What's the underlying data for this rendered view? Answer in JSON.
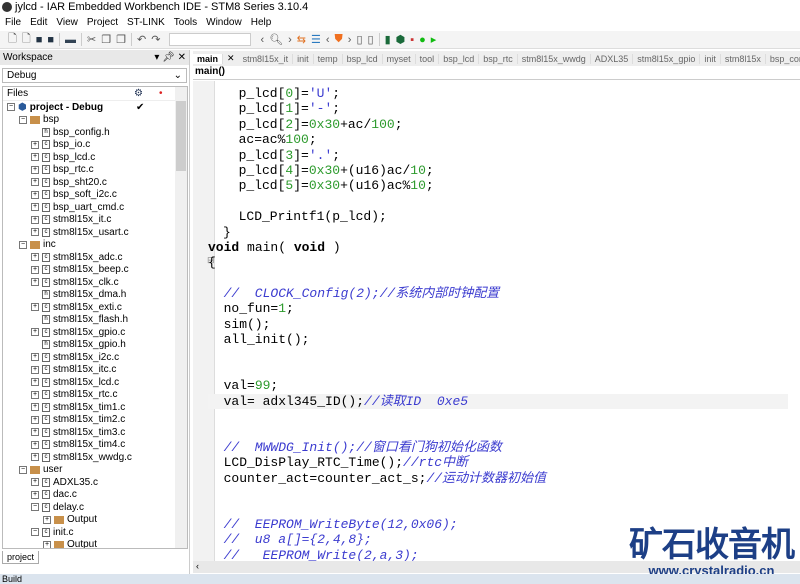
{
  "window": {
    "title": "jylcd - IAR Embedded Workbench IDE - STM8 Series 3.10.4"
  },
  "menu": [
    "File",
    "Edit",
    "View",
    "Project",
    "ST-LINK",
    "Tools",
    "Window",
    "Help"
  ],
  "toolbar": {
    "icons": [
      "new-file",
      "open",
      "save",
      "save-all",
      "print",
      "cut",
      "copy",
      "paste",
      "undo",
      "redo",
      "find-combo",
      "back",
      "find",
      "forward",
      "toggle-bookmark",
      "goto",
      "prev",
      "breakpoint",
      "next",
      "prev-bookmark",
      "next-bookmark",
      "compile",
      "make",
      "debug",
      "download-debug",
      "debug-no-download"
    ]
  },
  "workspace": {
    "title": "Workspace",
    "config": "Debug",
    "files_header": "Files",
    "tab": "project",
    "tree": [
      {
        "label": "project - Debug",
        "level": 0,
        "type": "project",
        "check": "✔"
      },
      {
        "label": "bsp",
        "level": 1,
        "type": "folder"
      },
      {
        "label": "bsp_config.h",
        "level": 2,
        "type": "h"
      },
      {
        "label": "bsp_io.c",
        "level": 2,
        "type": "c"
      },
      {
        "label": "bsp_lcd.c",
        "level": 2,
        "type": "c"
      },
      {
        "label": "bsp_rtc.c",
        "level": 2,
        "type": "c"
      },
      {
        "label": "bsp_sht20.c",
        "level": 2,
        "type": "c"
      },
      {
        "label": "bsp_soft_i2c.c",
        "level": 2,
        "type": "c"
      },
      {
        "label": "bsp_uart_cmd.c",
        "level": 2,
        "type": "c"
      },
      {
        "label": "stm8l15x_it.c",
        "level": 2,
        "type": "c"
      },
      {
        "label": "stm8l15x_usart.c",
        "level": 2,
        "type": "c"
      },
      {
        "label": "inc",
        "level": 1,
        "type": "folder"
      },
      {
        "label": "stm8l15x_adc.c",
        "level": 2,
        "type": "c"
      },
      {
        "label": "stm8l15x_beep.c",
        "level": 2,
        "type": "c"
      },
      {
        "label": "stm8l15x_clk.c",
        "level": 2,
        "type": "c"
      },
      {
        "label": "stm8l15x_dma.h",
        "level": 2,
        "type": "h"
      },
      {
        "label": "stm8l15x_exti.c",
        "level": 2,
        "type": "c"
      },
      {
        "label": "stm8l15x_flash.h",
        "level": 2,
        "type": "h"
      },
      {
        "label": "stm8l15x_gpio.c",
        "level": 2,
        "type": "c"
      },
      {
        "label": "stm8l15x_gpio.h",
        "level": 2,
        "type": "h"
      },
      {
        "label": "stm8l15x_i2c.c",
        "level": 2,
        "type": "c"
      },
      {
        "label": "stm8l15x_itc.c",
        "level": 2,
        "type": "c"
      },
      {
        "label": "stm8l15x_lcd.c",
        "level": 2,
        "type": "c"
      },
      {
        "label": "stm8l15x_rtc.c",
        "level": 2,
        "type": "c"
      },
      {
        "label": "stm8l15x_tim1.c",
        "level": 2,
        "type": "c"
      },
      {
        "label": "stm8l15x_tim2.c",
        "level": 2,
        "type": "c"
      },
      {
        "label": "stm8l15x_tim3.c",
        "level": 2,
        "type": "c"
      },
      {
        "label": "stm8l15x_tim4.c",
        "level": 2,
        "type": "c"
      },
      {
        "label": "stm8l15x_wwdg.c",
        "level": 2,
        "type": "c"
      },
      {
        "label": "user",
        "level": 1,
        "type": "folder"
      },
      {
        "label": "ADXL35.c",
        "level": 2,
        "type": "c"
      },
      {
        "label": "dac.c",
        "level": 2,
        "type": "c"
      },
      {
        "label": "delay.c",
        "level": 2,
        "type": "c"
      },
      {
        "label": "Output",
        "level": 3,
        "type": "folder"
      },
      {
        "label": "init.c",
        "level": 2,
        "type": "c"
      },
      {
        "label": "Output",
        "level": 3,
        "type": "folder"
      }
    ]
  },
  "editor": {
    "tabs": [
      "main",
      "stm8l15x_it",
      "init",
      "temp",
      "bsp_lcd",
      "myset",
      "tool",
      "bsp_lcd",
      "bsp_rtc",
      "stm8l15x_wwdg",
      "ADXL35",
      "stm8l15x_gpio",
      "init",
      "stm8l15x",
      "bsp_config",
      "ic"
    ],
    "active_tab": "main",
    "function_bar": "main()",
    "lines": [
      [
        [
          "  p_lcd[",
          ""
        ],
        [
          "0",
          "num"
        ],
        [
          "]=",
          ""
        ],
        [
          "'U'",
          "str"
        ],
        [
          ";",
          ""
        ]
      ],
      [
        [
          "  p_lcd[",
          ""
        ],
        [
          "1",
          "num"
        ],
        [
          "]=",
          ""
        ],
        [
          "'-'",
          "str"
        ],
        [
          ";",
          ""
        ]
      ],
      [
        [
          "  p_lcd[",
          ""
        ],
        [
          "2",
          "num"
        ],
        [
          "]=",
          ""
        ],
        [
          "0x30",
          "num"
        ],
        [
          "+ac/",
          ""
        ],
        [
          "100",
          "num"
        ],
        [
          ";",
          ""
        ]
      ],
      [
        [
          "  ac=ac%",
          ""
        ],
        [
          "100",
          "num"
        ],
        [
          ";",
          ""
        ]
      ],
      [
        [
          "  p_lcd[",
          ""
        ],
        [
          "3",
          "num"
        ],
        [
          "]=",
          ""
        ],
        [
          "'.'",
          "str"
        ],
        [
          ";",
          ""
        ]
      ],
      [
        [
          "  p_lcd[",
          ""
        ],
        [
          "4",
          "num"
        ],
        [
          "]=",
          ""
        ],
        [
          "0x30",
          "num"
        ],
        [
          "+(u16)ac/",
          ""
        ],
        [
          "10",
          "num"
        ],
        [
          ";",
          ""
        ]
      ],
      [
        [
          "  p_lcd[",
          ""
        ],
        [
          "5",
          "num"
        ],
        [
          "]=",
          ""
        ],
        [
          "0x30",
          "num"
        ],
        [
          "+(u16)ac%",
          ""
        ],
        [
          "10",
          "num"
        ],
        [
          ";",
          ""
        ]
      ],
      [],
      [
        [
          "  LCD_Printf1(p_lcd);",
          ""
        ]
      ],
      [
        [
          "}",
          ""
        ]
      ],
      [
        [
          "void",
          "kw"
        ],
        [
          " main( ",
          ""
        ],
        [
          "void",
          "kw"
        ],
        [
          " )",
          ""
        ]
      ],
      [
        [
          "{",
          ""
        ]
      ],
      [],
      [
        [
          "  //  CLOCK_Config(2);//系统内部时钟配置",
          "cmt"
        ]
      ],
      [
        [
          "  no_fun=",
          ""
        ],
        [
          "1",
          "num"
        ],
        [
          ";",
          ""
        ]
      ],
      [
        [
          "  sim();",
          ""
        ]
      ],
      [
        [
          "  all_init();",
          ""
        ]
      ],
      [],
      [],
      [
        [
          "  val=",
          ""
        ],
        [
          "99",
          "num"
        ],
        [
          ";",
          ""
        ]
      ],
      [
        [
          "  val= adxl345_ID();",
          ""
        ],
        [
          "//读取ID  0xe5",
          "cmt"
        ]
      ],
      [],
      [],
      [
        [
          "  //  MWWDG_Init();//窗口看门狗初始化函数",
          "cmt"
        ]
      ],
      [
        [
          "  LCD_DisPlay_RTC_Time();",
          ""
        ],
        [
          "//rtc中断",
          "cmt"
        ]
      ],
      [
        [
          "  counter_act=counter_act_s;",
          ""
        ],
        [
          "//运动计数器初始值",
          "cmt"
        ]
      ],
      [],
      [],
      [
        [
          "  //  EEPROM_WriteByte(12,0x06);",
          "cmt"
        ]
      ],
      [
        [
          "  //  u8 a[]={2,4,8};",
          "cmt"
        ]
      ],
      [
        [
          "  //   EEPROM_Write(2,a,3);",
          "cmt"
        ]
      ]
    ]
  },
  "status": {
    "build_label": "Build"
  },
  "watermark": {
    "text": "矿石收音机",
    "url": "www.crystalradio.cn",
    "color": "#1d3f86"
  }
}
